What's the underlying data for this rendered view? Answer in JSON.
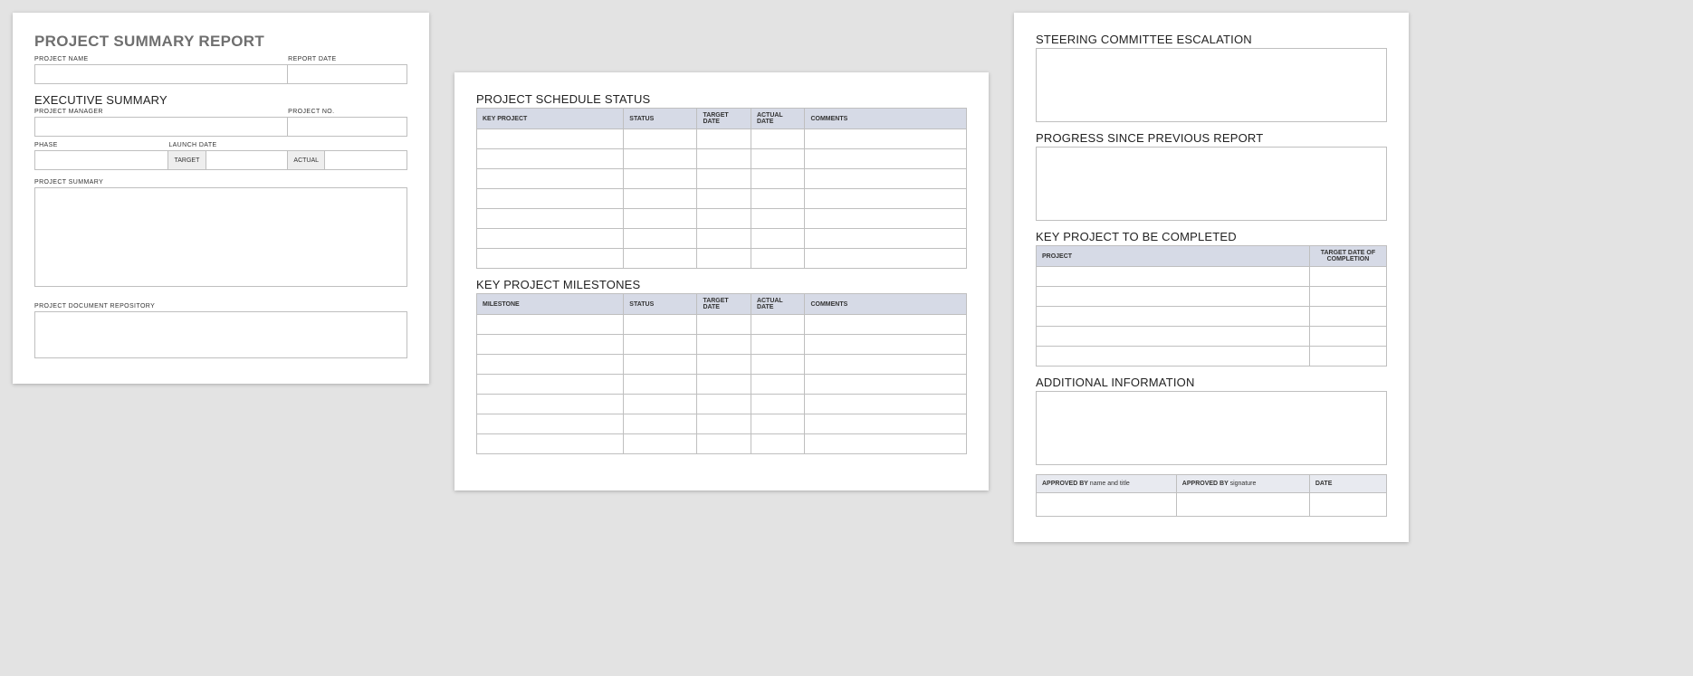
{
  "page1": {
    "title": "PROJECT SUMMARY REPORT",
    "fields": {
      "project_name": "PROJECT NAME",
      "report_date": "REPORT DATE",
      "executive_summary": "EXECUTIVE SUMMARY",
      "project_manager": "PROJECT MANAGER",
      "project_no": "PROJECT NO.",
      "phase": "PHASE",
      "launch_date": "LAUNCH DATE",
      "target": "TARGET",
      "actual": "ACTUAL",
      "project_summary": "PROJECT SUMMARY",
      "project_doc_repo": "PROJECT DOCUMENT REPOSITORY"
    }
  },
  "page2": {
    "schedule_title": "PROJECT SCHEDULE STATUS",
    "schedule_headers": {
      "key": "KEY PROJECT",
      "status": "STATUS",
      "target_date": "TARGET DATE",
      "actual_date": "ACTUAL DATE",
      "comments": "COMMENTS"
    },
    "milestones_title": "KEY PROJECT MILESTONES",
    "milestones_headers": {
      "milestone": "MILESTONE",
      "status": "STATUS",
      "target_date": "TARGET DATE",
      "actual_date": "ACTUAL DATE",
      "comments": "COMMENTS"
    }
  },
  "page3": {
    "steering_title": "STEERING COMMITTEE ESCALATION",
    "progress_title": "PROGRESS SINCE PREVIOUS REPORT",
    "keyproj_title": "KEY PROJECT TO BE COMPLETED",
    "keyproj_headers": {
      "project": "PROJECT",
      "target_date_completion": "TARGET DATE OF COMPLETION"
    },
    "additional_title": "ADDITIONAL INFORMATION",
    "approval": {
      "approved_by_label": "APPROVED BY",
      "name_and_title_hint": "name and title",
      "signature_hint": "signature",
      "date_label": "DATE"
    }
  }
}
